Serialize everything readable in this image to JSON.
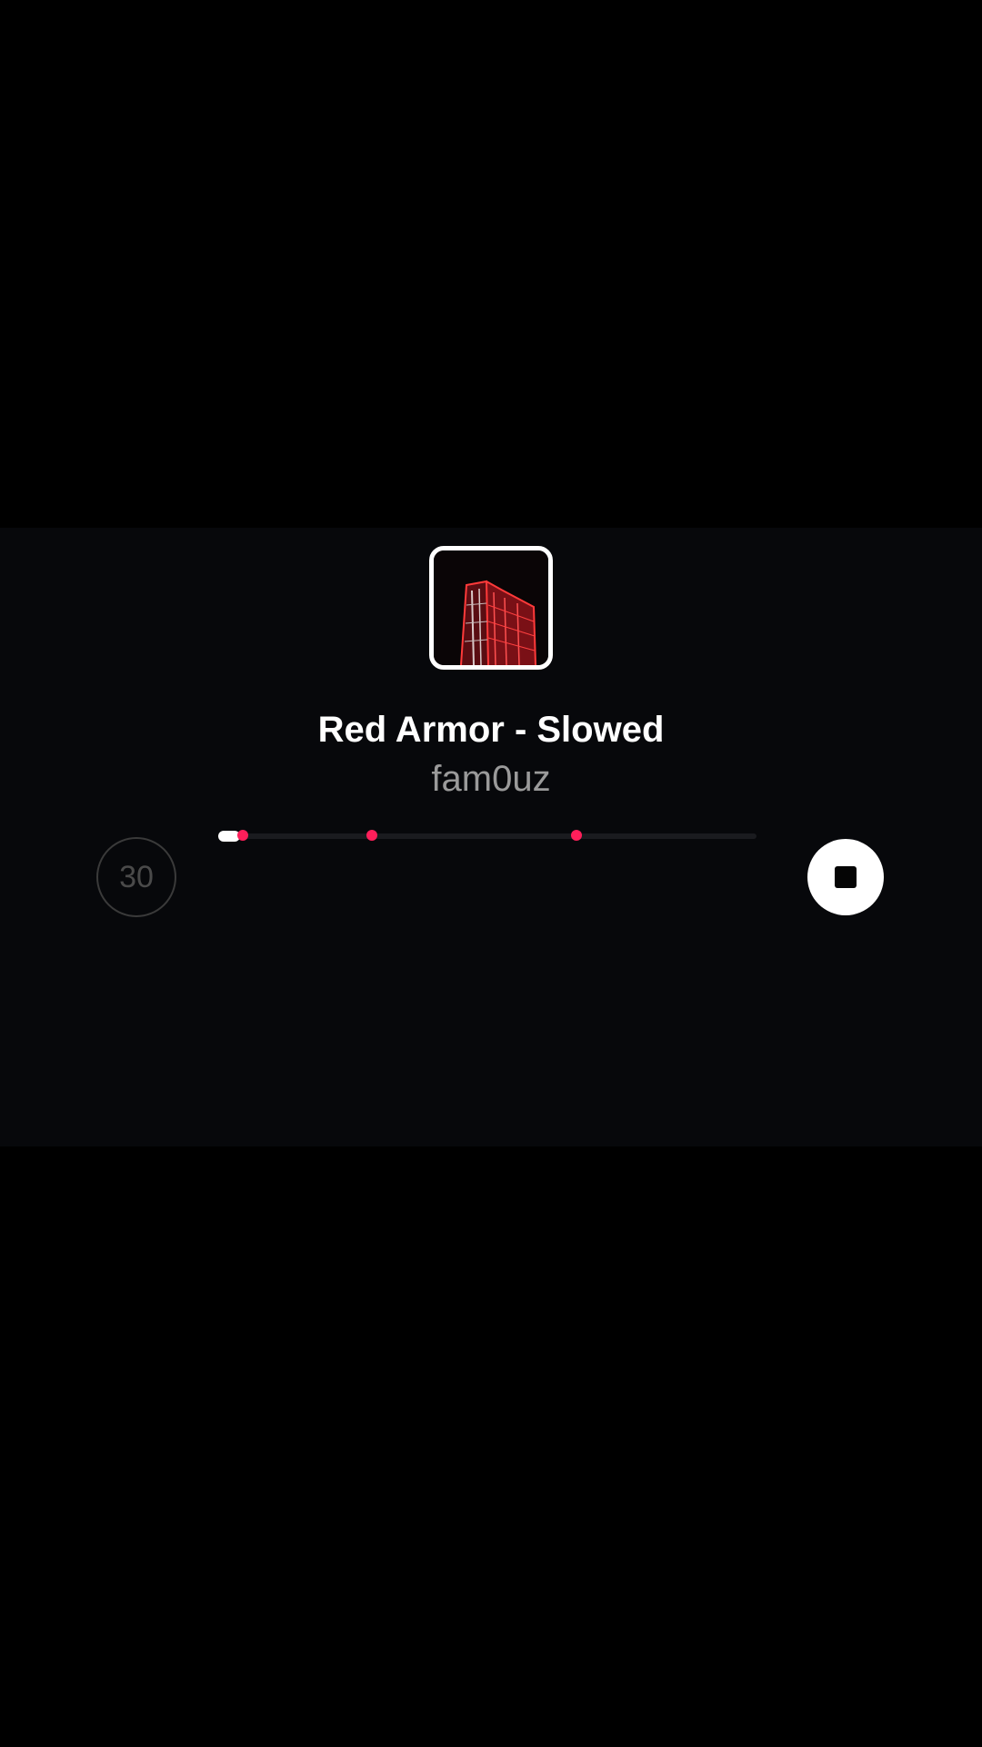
{
  "track": {
    "title": "Red Armor - Slowed",
    "artist": "fam0uz",
    "cover_icon": "album-cover-red-building"
  },
  "player": {
    "duration_label": "30",
    "progress_fraction": 0.04,
    "marker_fractions": [
      0.045,
      0.285,
      0.665
    ],
    "stop_icon": "stop-icon"
  },
  "colors": {
    "background": "#000000",
    "panel": "#07080b",
    "accent": "#ff1f5a",
    "title": "#ffffff",
    "artist": "#9a9a9a"
  }
}
